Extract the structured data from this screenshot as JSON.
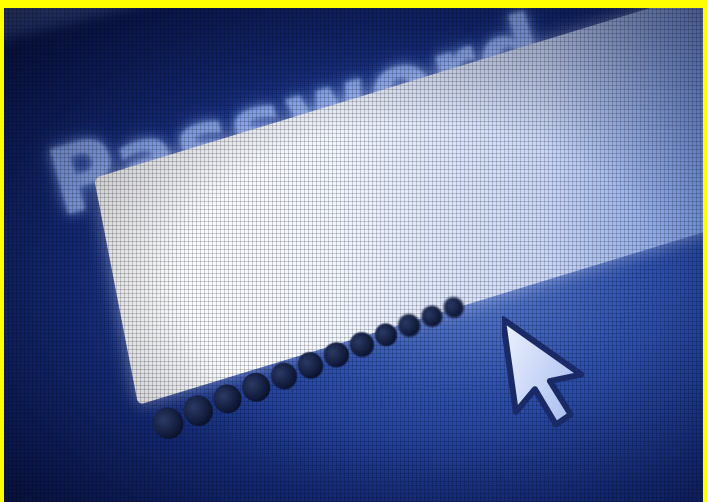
{
  "label_text": "Password",
  "password_mask": {
    "dot_count": 12
  },
  "icons": {
    "pointer": "mouse-pointer-icon"
  },
  "colors": {
    "border": "#ffff00",
    "background": "#16308a",
    "label_glow": "#8fb0ff",
    "field": "#ffffff",
    "dot": "#0b1330"
  }
}
